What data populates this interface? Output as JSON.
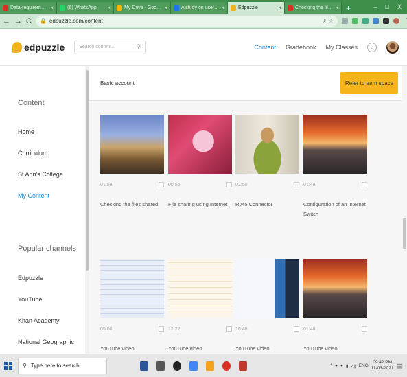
{
  "browser": {
    "tabs": [
      {
        "title": "Data-requirement-Wo",
        "color": "#d93025",
        "active": false
      },
      {
        "title": "(6) WhatsApp",
        "color": "#25d366",
        "active": false
      },
      {
        "title": "My Drive - Google Dri",
        "color": "#f4b400",
        "active": false
      },
      {
        "title": "A study on useful tech",
        "color": "#1a73e8",
        "active": false
      },
      {
        "title": "Edpuzzle",
        "color": "#f1b21d",
        "active": true
      },
      {
        "title": "Checking the files sha",
        "color": "#d93025",
        "active": false
      }
    ],
    "new_tab": "+",
    "window_controls": [
      "–",
      "□",
      "X"
    ],
    "url": "edpuzzle.com/content"
  },
  "app": {
    "logo_text": "edpuzzle",
    "search_placeholder": "Search content...",
    "nav": {
      "content": "Content",
      "gradebook": "Gradebook",
      "my_classes": "My Classes"
    },
    "help": "?"
  },
  "sidebar": {
    "content_heading": "Content",
    "items": [
      {
        "label": "Home",
        "active": false
      },
      {
        "label": "Curriculum",
        "active": false
      },
      {
        "label": "St Ann's College",
        "active": false
      },
      {
        "label": "My Content",
        "active": true
      }
    ],
    "channels_heading": "Popular channels",
    "channels": [
      "Edpuzzle",
      "YouTube",
      "Khan Academy",
      "National Geographic"
    ]
  },
  "main": {
    "banner_text": "Basic account",
    "cta_label": "Refer to earn space",
    "cards": [
      {
        "duration": "01:58",
        "title": "Checking the files shared",
        "thumb": "coast"
      },
      {
        "duration": "00:55",
        "title": "File sharing using Internet",
        "thumb": "pinkdesk"
      },
      {
        "duration": "02:50",
        "title": "RJ45 Connector",
        "thumb": "person"
      },
      {
        "duration": "01:48",
        "title": "Configuration of an Internet Switch",
        "thumb": "sunset"
      },
      {
        "duration": "05:00",
        "title": "YouTube video",
        "thumb": "spreadsheet"
      },
      {
        "duration": "12:22",
        "title": "YouTube video",
        "thumb": "notes"
      },
      {
        "duration": "16:48",
        "title": "YouTube video",
        "thumb": "math"
      },
      {
        "duration": "01:48",
        "title": "YouTube video",
        "thumb": "sunset"
      }
    ]
  },
  "taskbar": {
    "search_placeholder": "Type here to search",
    "lang": "ENG",
    "time": "09:42 PM",
    "date": "11-03-2021"
  }
}
